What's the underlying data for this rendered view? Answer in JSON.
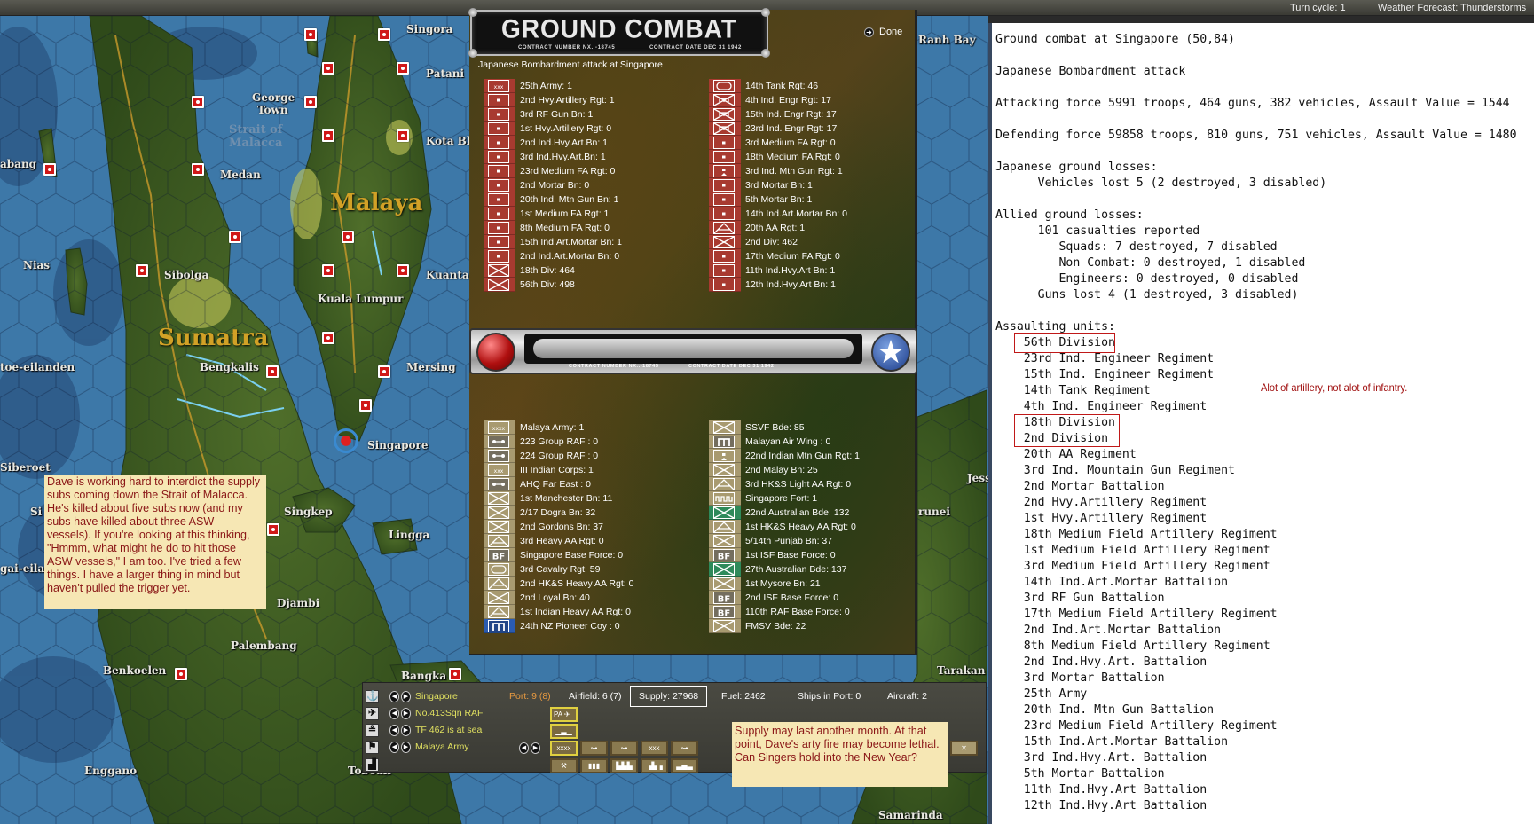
{
  "topbar": {
    "turn_cycle": "Turn cycle: 1",
    "weather": "Weather Forecast: Thunderstorms"
  },
  "map": {
    "labels": {
      "singora": "Singora",
      "patani": "Patani",
      "george_town_1": "George",
      "george_town_2": "Town",
      "strait_1": "Strait of",
      "strait_2": "Malacca",
      "kota_bh": "Kota Bh",
      "abang": "abang",
      "medan": "Medan",
      "malaya": "Malaya",
      "nias": "Nias",
      "sibolga": "Sibolga",
      "kuantan": "Kuantan",
      "kuala_lumpur": "Kuala Lumpur",
      "sumatra": "Sumatra",
      "toe_eilanden": "toe-eilanden",
      "bengkalis": "Bengkalis",
      "mersing": "Mersing",
      "singapore": "Singapore",
      "siberoet": "Siberoet",
      "si": "Si",
      "gai_eilan": "gai-eilan",
      "singkep": "Singkep",
      "lingga": "Lingga",
      "djambi": "Djambi",
      "palembang": "Palembang",
      "benkoelen": "Benkoelen",
      "bangka": "Bangka",
      "enggano": "Enggano",
      "toboali": "Toboali",
      "tarakan": "Tarakan",
      "samarinda": "Samarinda",
      "jess": "Jess",
      "brunei": "runei",
      "ranh_bay": "Ranh Bay"
    }
  },
  "dialog": {
    "title": "GROUND COMBAT",
    "contract_number": "CONTRACT NUMBER   NX..-18745",
    "contract_date": "CONTRACT DATE  DEC  31  1942",
    "done_label": "Done",
    "subtitle": "Japanese Bombardment attack at Singapore",
    "attackers_left": [
      {
        "label": "25th Army: 1",
        "icon": "hq3"
      },
      {
        "label": "2nd Hvy.Artillery Rgt: 1",
        "icon": "art"
      },
      {
        "label": "3rd RF Gun Bn: 1",
        "icon": "art"
      },
      {
        "label": "1st Hvy.Artillery Rgt: 0",
        "icon": "art"
      },
      {
        "label": "2nd Ind.Hvy.Art.Bn: 1",
        "icon": "art"
      },
      {
        "label": "3rd Ind.Hvy.Art.Bn: 1",
        "icon": "art"
      },
      {
        "label": "23rd Medium FA Rgt: 0",
        "icon": "art"
      },
      {
        "label": "2nd Mortar Bn: 0",
        "icon": "art"
      },
      {
        "label": "20th Ind. Mtn Gun Bn: 1",
        "icon": "art"
      },
      {
        "label": "1st Medium FA Rgt: 1",
        "icon": "art"
      },
      {
        "label": "8th Medium FA Rgt: 0",
        "icon": "art"
      },
      {
        "label": "15th Ind.Art.Mortar Bn: 1",
        "icon": "art"
      },
      {
        "label": "2nd Ind.Art.Mortar Bn: 0",
        "icon": "art"
      },
      {
        "label": "18th Div: 464",
        "icon": "inf"
      },
      {
        "label": "56th Div: 498",
        "icon": "inf"
      }
    ],
    "attackers_right": [
      {
        "label": "14th Tank Rgt: 46",
        "icon": "tank"
      },
      {
        "label": "4th Ind. Engr Rgt: 17",
        "icon": "eng"
      },
      {
        "label": "15th Ind. Engr Rgt: 17",
        "icon": "eng"
      },
      {
        "label": "23rd Ind. Engr Rgt: 17",
        "icon": "eng"
      },
      {
        "label": "3rd Medium FA Rgt: 0",
        "icon": "art"
      },
      {
        "label": "18th Medium FA Rgt: 0",
        "icon": "art"
      },
      {
        "label": "3rd Ind. Mtn Gun Rgt: 1",
        "icon": "mtn"
      },
      {
        "label": "3rd Mortar Bn: 1",
        "icon": "art"
      },
      {
        "label": "5th Mortar Bn: 1",
        "icon": "art"
      },
      {
        "label": "14th Ind.Art.Mortar Bn: 0",
        "icon": "art"
      },
      {
        "label": "20th AA Rgt: 1",
        "icon": "aa"
      },
      {
        "label": "2nd Div: 462",
        "icon": "inf"
      },
      {
        "label": "17th Medium FA Rgt: 0",
        "icon": "art"
      },
      {
        "label": "11th Ind.Hvy.Art Bn: 1",
        "icon": "art"
      },
      {
        "label": "12th Ind.Hvy.Art Bn: 1",
        "icon": "art"
      }
    ],
    "defenders_left": [
      {
        "label": "Malaya Army: 1",
        "icon": "hq4",
        "color": "al"
      },
      {
        "label": "223 Group RAF : 0",
        "icon": "air",
        "color": "al"
      },
      {
        "label": "224 Group RAF : 0",
        "icon": "air",
        "color": "al"
      },
      {
        "label": "III Indian Corps: 1",
        "icon": "hq3",
        "color": "al"
      },
      {
        "label": "AHQ Far East : 0",
        "icon": "air",
        "color": "al"
      },
      {
        "label": "1st Manchester Bn: 11",
        "icon": "inf",
        "color": "al"
      },
      {
        "label": "2/17 Dogra Bn: 32",
        "icon": "inf",
        "color": "al"
      },
      {
        "label": "2nd Gordons Bn: 37",
        "icon": "inf",
        "color": "al"
      },
      {
        "label": "3rd Heavy AA Rgt: 0",
        "icon": "aa",
        "color": "al"
      },
      {
        "label": "Singapore Base Force: 0",
        "icon": "bf",
        "color": "al"
      },
      {
        "label": "3rd Cavalry Rgt: 59",
        "icon": "tank",
        "color": "al"
      },
      {
        "label": "2nd HK&S Heavy AA Rgt: 0",
        "icon": "aa",
        "color": "al"
      },
      {
        "label": "2nd Loyal Bn: 40",
        "icon": "inf",
        "color": "al"
      },
      {
        "label": "1st Indian Heavy AA Rgt: 0",
        "icon": "aa",
        "color": "al"
      },
      {
        "label": "24th NZ Pioneer Coy : 0",
        "icon": "pio",
        "color": "blu"
      }
    ],
    "defenders_right": [
      {
        "label": "SSVF Bde: 85",
        "icon": "inf",
        "color": "al"
      },
      {
        "label": "Malayan Air Wing : 0",
        "icon": "pio",
        "color": "al"
      },
      {
        "label": "22nd Indian Mtn Gun Rgt: 1",
        "icon": "mtn",
        "color": "al"
      },
      {
        "label": "2nd Malay Bn: 25",
        "icon": "inf",
        "color": "al"
      },
      {
        "label": "3rd HK&S Light AA Rgt: 0",
        "icon": "aa",
        "color": "al"
      },
      {
        "label": "Singapore Fort: 1",
        "icon": "fort",
        "color": "al"
      },
      {
        "label": "22nd Australian Bde: 132",
        "icon": "inf",
        "color": "grn"
      },
      {
        "label": "1st HK&S Heavy AA Rgt: 0",
        "icon": "aa",
        "color": "al"
      },
      {
        "label": "5/14th Punjab Bn: 37",
        "icon": "inf",
        "color": "al"
      },
      {
        "label": "1st ISF Base Force: 0",
        "icon": "bf",
        "color": "al"
      },
      {
        "label": "27th Australian Bde: 137",
        "icon": "inf",
        "color": "grn"
      },
      {
        "label": "1st Mysore Bn: 21",
        "icon": "inf",
        "color": "al"
      },
      {
        "label": "2nd ISF Base Force: 0",
        "icon": "bf",
        "color": "al"
      },
      {
        "label": "110th RAF Base Force: 0",
        "icon": "bf",
        "color": "al"
      },
      {
        "label": "FMSV Bde: 22",
        "icon": "inf",
        "color": "al"
      }
    ]
  },
  "infobar": {
    "base": "Singapore",
    "air_unit": "No.413Sqn RAF",
    "task_force": "TF 462 is at sea",
    "ground_unit": "Malaya Army",
    "port": "Port: 9 (8)",
    "airfield": "Airfield: 6 (7)",
    "supply": "Supply: 27968",
    "fuel": "Fuel: 2462",
    "ships_in_port": "Ships in Port: 0",
    "aircraft": "Aircraft: 2",
    "pa_label": "PA"
  },
  "notes": {
    "left": [
      "Dave is working hard to interdict the supply",
      "subs coming down the Strait of Malacca.",
      "He's killed about five subs now (and my",
      "subs have killed about three ASW",
      "vessels).  If you're looking at this thinking,",
      "\"Hmmm, what might he do to hit those",
      "ASW vessels,\" I am too.  I've tried a few",
      "things.  I have a larger thing in mind but",
      "haven't pulled the trigger yet."
    ],
    "bottom": [
      "Supply may last another month.  At that",
      "point, Dave's arty fire may become lethal.",
      "Can Singers hold into the New Year?"
    ],
    "report_comment": "Alot of artillery, not alot of infantry."
  },
  "report": {
    "lines": [
      "Ground combat at Singapore (50,84)",
      "",
      "Japanese Bombardment attack",
      "",
      "Attacking force 5991 troops, 464 guns, 382 vehicles, Assault Value = 1544",
      "",
      "Defending force 59858 troops, 810 guns, 751 vehicles, Assault Value = 1480",
      "",
      "Japanese ground losses:",
      "      Vehicles lost 5 (2 destroyed, 3 disabled)",
      "",
      "Allied ground losses:",
      "      101 casualties reported",
      "         Squads: 7 destroyed, 7 disabled",
      "         Non Combat: 0 destroyed, 1 disabled",
      "         Engineers: 0 destroyed, 0 disabled",
      "      Guns lost 4 (1 destroyed, 3 disabled)",
      "",
      "Assaulting units:",
      "    56th Division",
      "    23rd Ind. Engineer Regiment",
      "    15th Ind. Engineer Regiment",
      "    14th Tank Regiment",
      "    4th Ind. Engineer Regiment",
      "    18th Division",
      "    2nd Division",
      "    20th AA Regiment",
      "    3rd Ind. Mountain Gun Regiment",
      "    2nd Mortar Battalion",
      "    2nd Hvy.Artillery Regiment",
      "    1st Hvy.Artillery Regiment",
      "    18th Medium Field Artillery Regiment",
      "    1st Medium Field Artillery Regiment",
      "    3rd Medium Field Artillery Regiment",
      "    14th Ind.Art.Mortar Battalion",
      "    3rd RF Gun Battalion",
      "    17th Medium Field Artillery Regiment",
      "    2nd Ind.Art.Mortar Battalion",
      "    8th Medium Field Artillery Regiment",
      "    2nd Ind.Hvy.Art. Battalion",
      "    3rd Mortar Battalion",
      "    25th Army",
      "    20th Ind. Mtn Gun Battalion",
      "    23rd Medium Field Artillery Regiment",
      "    15th Ind.Art.Mortar Battalion",
      "    3rd Ind.Hvy.Art. Battalion",
      "    5th Mortar Battalion",
      "    11th Ind.Hvy.Art Battalion",
      "    12th Ind.Hvy.Art Battalion"
    ]
  },
  "colors": {
    "japanese": "#a83a30",
    "allied": "#a89a70",
    "note_text": "#8a1616",
    "note_bg": "#f6e7b4",
    "ocean": "#3d78a8"
  }
}
